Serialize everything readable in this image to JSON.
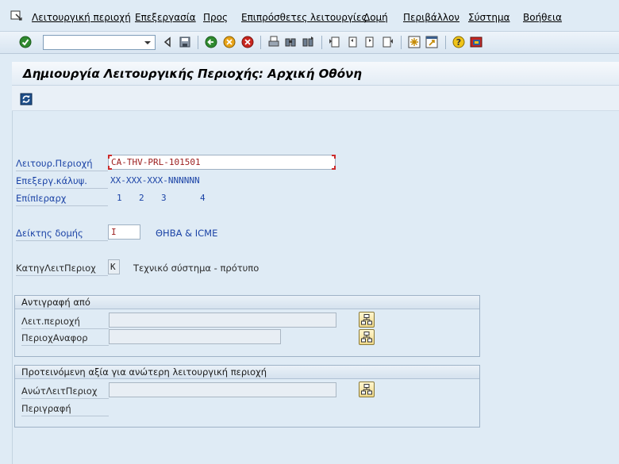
{
  "menu": {
    "items": [
      "Λειτουργική περιοχή",
      "Επεξεργασία",
      "Προς",
      "Επιπρόσθετες λειτουργίες",
      "Δομή",
      "Περιβάλλον",
      "Σύστημα",
      "Βοήθεια"
    ]
  },
  "toolbar": {
    "command_value": "",
    "icons": [
      "enter-icon",
      "back-arrow-icon",
      "save-icon",
      "back-icon",
      "exit-icon",
      "cancel-icon",
      "print-icon",
      "find-icon",
      "find-next-icon",
      "first-page-icon",
      "previous-page-icon",
      "next-page-icon",
      "last-page-icon",
      "create-session-icon",
      "shortcut-icon",
      "help-icon",
      "layout-icon"
    ]
  },
  "title": "Δημιουργία Λειτουργικής Περιοχής: Αρχική Οθόνη",
  "fields": {
    "functional_location": {
      "label": "Λειτουρ.Περιοχή",
      "value": "CA-THV-PRL-101501"
    },
    "edit_mask": {
      "label": "Επεξεργ.κάλυψ.",
      "value": "XX-XXX-XXX-NNNNNN"
    },
    "hierarchy_levels": {
      "label": "ΕπίπΙεραρχ",
      "levels": [
        "1",
        "2",
        "3",
        "4"
      ]
    },
    "structure_indicator": {
      "label": "Δείκτης δομής",
      "value": "I",
      "description": "ΘΗΒΑ & ICME"
    },
    "category": {
      "label": "ΚατηγΛειτΠεριοχ",
      "value": "K",
      "description": "Τεχνικό σύστημα - πρότυπο"
    }
  },
  "copy_from": {
    "title": "Αντιγραφή από",
    "func_loc_label": "Λειτ.περιοχή",
    "func_loc_value": "",
    "reference_label": "ΠεριοχΑναφορ",
    "reference_value": ""
  },
  "proposed_superior": {
    "title": "Προτεινόμενη αξία για ανώτερη λειτουργική περιοχή",
    "superior_label": "ΑνώτΛειτΠεριοχ",
    "superior_value": "",
    "description_label": "Περιγραφή"
  }
}
